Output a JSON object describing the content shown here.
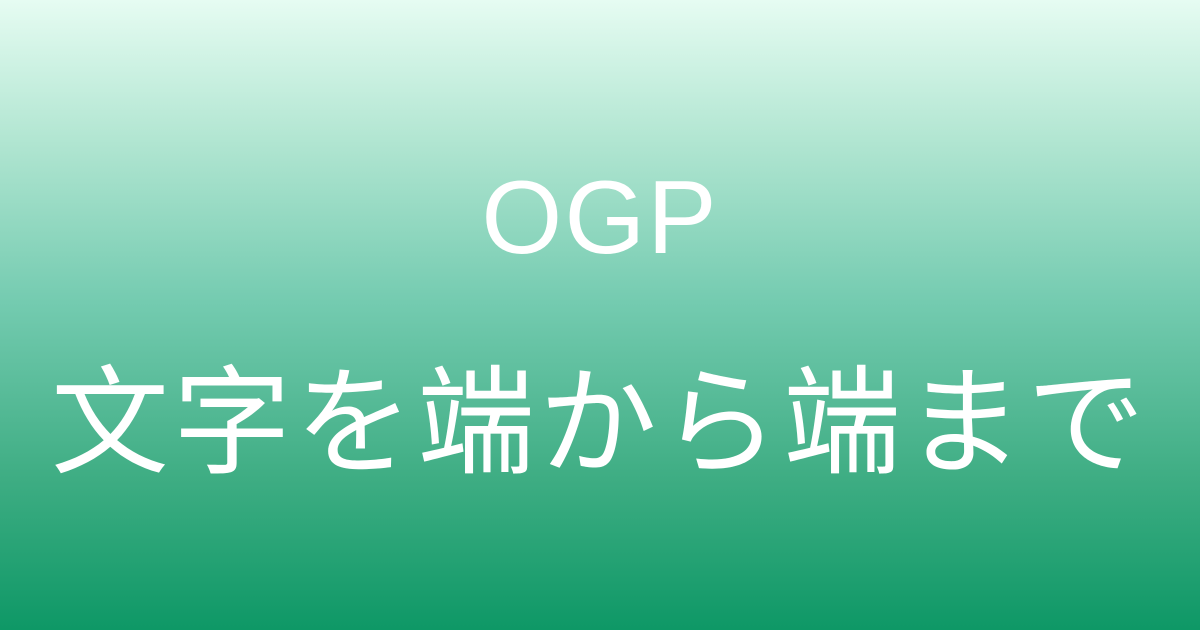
{
  "image": {
    "line_1": "OGP",
    "line_2": "文字を端から端まで",
    "gradient_top_color": "#e6fcf2",
    "gradient_bottom_color": "#0e9866",
    "text_color": "#ffffff"
  }
}
